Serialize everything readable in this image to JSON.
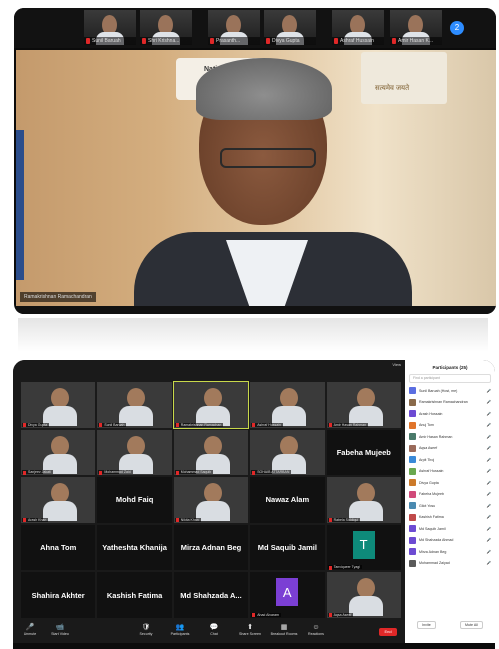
{
  "top_screenshot": {
    "gallery_strip": [
      {
        "name": "Sunil Baruah"
      },
      {
        "name": "Shri Krishna..."
      },
      {
        "name": "Prasanth..."
      },
      {
        "name": "Divya Gupta"
      },
      {
        "name": "Ashraf Hussain"
      },
      {
        "name": "Amir Hasan K..."
      }
    ],
    "next_page_label": "2",
    "speaker_name": "Ramakrishnan Ramachandran",
    "banner_text": "National",
    "emblem_text": "सत्यमेव जयते"
  },
  "bottom_screenshot": {
    "view_label": "View",
    "tiles": [
      {
        "type": "video",
        "caption": "Divya Gupta"
      },
      {
        "type": "video",
        "caption": "Sunil Baruah"
      },
      {
        "type": "video",
        "caption": "Ramakrishnan Ramachan",
        "active": true
      },
      {
        "type": "video",
        "caption": "Ashraf Hussain"
      },
      {
        "type": "video",
        "caption": "Amir Hasan Rahman"
      },
      {
        "type": "video",
        "caption": "Sanjeev Jakati"
      },
      {
        "type": "video",
        "caption": "Mohammad Zaid"
      },
      {
        "type": "video",
        "caption": "Mohammad Saquib"
      },
      {
        "type": "video",
        "caption": "SOHAIB ATTARBAN"
      },
      {
        "type": "name",
        "name": "Fabeha Mujeeb",
        "caption": ""
      },
      {
        "type": "video",
        "caption": "Arash Khan"
      },
      {
        "type": "name",
        "name": "Mohd Faiq",
        "caption": ""
      },
      {
        "type": "video",
        "caption": "Nikita Khan"
      },
      {
        "type": "name",
        "name": "Nawaz Alam",
        "caption": ""
      },
      {
        "type": "video",
        "caption": "Rabela Siddiqui"
      },
      {
        "type": "name",
        "name": "Ahna Tom",
        "caption": ""
      },
      {
        "type": "name",
        "name": "Yatheshta Khanija",
        "caption": ""
      },
      {
        "type": "name",
        "name": "Mirza Adnan Beg",
        "caption": ""
      },
      {
        "type": "name",
        "name": "Md Saquib Jamil",
        "caption": ""
      },
      {
        "type": "avatar",
        "letter": "T",
        "color": "#0e8a7a",
        "caption": "Tanviqueer Tyagi"
      },
      {
        "type": "name",
        "name": "Shahira Akhter",
        "caption": ""
      },
      {
        "type": "name",
        "name": "Kashish Fatima",
        "caption": ""
      },
      {
        "type": "name",
        "name": "Md Shahzada A...",
        "caption": ""
      },
      {
        "type": "avatar",
        "letter": "A",
        "color": "#7b3fd4",
        "caption": "Ahad Alvaram"
      },
      {
        "type": "video",
        "caption": "Aqsa Aseef"
      }
    ],
    "participants_panel": {
      "title": "Participants (25)",
      "search_placeholder": "Find a participant",
      "items": [
        {
          "name": "Sunil Baruah (Host, me)",
          "color": "#5b6ee1"
        },
        {
          "name": "Ramakrishnan Ramachandran",
          "color": "#8a6a4a"
        },
        {
          "name": "Arash Hossain",
          "color": "#6d4bd3"
        },
        {
          "name": "Anuj Tom",
          "color": "#e0742a"
        },
        {
          "name": "Amir Hasan Rahman",
          "color": "#4a7a6a"
        },
        {
          "name": "Aqsa Aseef",
          "color": "#9a6a5a"
        },
        {
          "name": "Arpit Tiroj",
          "color": "#3a8ad8"
        },
        {
          "name": "Ashraf Hussain",
          "color": "#6aa84f"
        },
        {
          "name": "Divya Gupta",
          "color": "#cc7a2a"
        },
        {
          "name": "Fabeha Mujeeb",
          "color": "#d14a7a"
        },
        {
          "name": "Gilot Yosu",
          "color": "#4a8ab0"
        },
        {
          "name": "Kashish Fatima",
          "color": "#c04a4a"
        },
        {
          "name": "Md Saquib Jamil",
          "color": "#6d4bd3"
        },
        {
          "name": "Md Shahzada Ahmad",
          "color": "#6d4bd3"
        },
        {
          "name": "Mirza Adnan Beg",
          "color": "#6d4bd3"
        },
        {
          "name": "Mohammad Zaiyad",
          "color": "#5a5a5a"
        }
      ],
      "invite_label": "Invite",
      "mute_all_label": "Mute All"
    },
    "toolbar": [
      {
        "label": "Unmute",
        "icon": "🎤"
      },
      {
        "label": "Start Video",
        "icon": "📹"
      },
      {
        "label": "Security",
        "icon": "🛡"
      },
      {
        "label": "Participants",
        "icon": "👥"
      },
      {
        "label": "Chat",
        "icon": "💬"
      },
      {
        "label": "Share Screen",
        "icon": "⬆"
      },
      {
        "label": "Breakout Rooms",
        "icon": "▦"
      },
      {
        "label": "Reactions",
        "icon": "☺"
      }
    ],
    "end_label": "End"
  }
}
